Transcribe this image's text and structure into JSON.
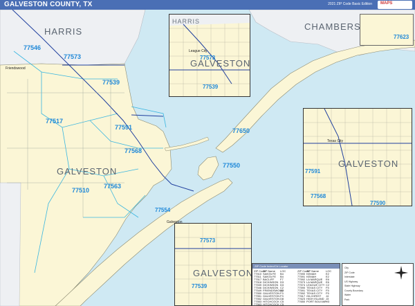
{
  "header": {
    "title": "GALVESTON COUNTY, TX",
    "subtitle": "2021 ZIP Code Basic Edition",
    "brand": "MAPS"
  },
  "colors": {
    "land": "#fbf6d6",
    "water": "#cfe9f3",
    "zip_label": "#1e88d8",
    "header": "#4a6fb5",
    "highway": "#1f3f9e"
  },
  "main_map": {
    "counties": {
      "harris": "HARRIS",
      "chambers": "CHAMBERS",
      "galveston": "GALVESTON"
    },
    "zips": {
      "z77546": "77546",
      "z77573": "77573",
      "z77539": "77539",
      "z77517": "77517",
      "z77591": "77591",
      "z77568": "77568",
      "z77510": "77510",
      "z77563": "77563",
      "z77650": "77650",
      "z77550": "77550",
      "z77554": "77554",
      "z77518": "77518"
    },
    "cities": {
      "friendswood": "Friendswood",
      "galveston": "Galveston"
    }
  },
  "insets": {
    "top": {
      "county_top": "HARRIS",
      "county": "GALVESTON",
      "zip_a": "77573",
      "zip_b": "77539",
      "city": "League City"
    },
    "right": {
      "county": "GALVESTON",
      "zip_a": "77591",
      "zip_b": "77568",
      "zip_c": "77590",
      "city": "Texas City"
    },
    "bottom": {
      "county": "GALVESTON",
      "zip_a": "77573",
      "zip_b": "77539"
    },
    "top_right_zip": "77623"
  },
  "zip_index": {
    "title": "ZIP Code Index/Ctr Locator",
    "headers": [
      "ZIP Code",
      "ZIP Name",
      "LOC",
      "ZIP Code",
      "ZIP Name",
      "LOC"
    ],
    "rows": [
      [
        "77510",
        "SANTA FE",
        "B4",
        "77590",
        "KEMAH",
        "E2"
      ],
      [
        "77511",
        "SANTA FE",
        "B4",
        "77591",
        "KEMAH",
        "E2"
      ],
      [
        "77517",
        "BACLIFF",
        "F7",
        "77592",
        "LA MARQUE",
        "E6"
      ],
      [
        "77518",
        "DICKINSON",
        "D3",
        "77573",
        "LA MARQUE",
        "E6"
      ],
      [
        "77539",
        "DICKINSON",
        "D3",
        "77574",
        "LEAGUE CITY",
        "C2"
      ],
      [
        "77546",
        "DICKINSON",
        "C2",
        "77590",
        "TEXAS CITY",
        "F5"
      ],
      [
        "77549",
        "FRIENDSWOOD",
        "A2",
        "77591",
        "TEXAS CITY",
        "F5"
      ],
      [
        "77550",
        "GALVESTON",
        "F3",
        "77592",
        "TEXAS CITY",
        "F5"
      ],
      [
        "77551",
        "GALVESTON",
        "F3",
        "77617",
        "GILCHRIST",
        "J4"
      ],
      [
        "77552",
        "GALVESTON",
        "D8",
        "77623",
        "HIGH ISLAND",
        "J3"
      ],
      [
        "77553",
        "HITCHCOCK",
        "C5",
        "77650",
        "PORT BOLIVAR",
        "H3"
      ],
      [
        "77563",
        "HITCHCOCK",
        "C5",
        "",
        "",
        ""
      ],
      [
        "77565",
        "KEMAH",
        "E2",
        "",
        "",
        ""
      ]
    ]
  },
  "legend_key": {
    "items": [
      "City",
      "ZIP Code",
      "Interstate",
      "US Highway",
      "State Highway",
      "County Boundary",
      "Water",
      "Park"
    ]
  }
}
